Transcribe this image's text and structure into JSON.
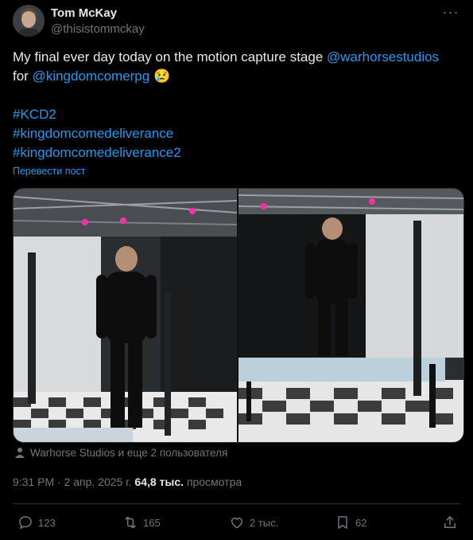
{
  "author": {
    "name": "Tom McKay",
    "handle": "@thisistommckay"
  },
  "post": {
    "text_part1": "My final ever day today on the motion capture stage ",
    "mention1": "@warhorsestudios",
    "text_part2": "for ",
    "mention2": "@kingdomcomerpg",
    "emoji": "😢",
    "hashtags": [
      "#KCD2",
      "#kingdomcomedeliverance",
      "#kingdomcomedeliverance2"
    ],
    "translate_label": "Перевести пост"
  },
  "tagged": {
    "text": "Warhorse Studios и еще 2 пользователя"
  },
  "meta": {
    "time": "9:31 PM",
    "separator": " · ",
    "date": "2 апр. 2025 г.",
    "views_value": "64,8 тыс.",
    "views_label": "просмотра"
  },
  "actions": {
    "replies": "123",
    "reposts": "165",
    "likes": "2 тыс.",
    "bookmarks": "62"
  },
  "colors": {
    "accent": "#1d9bf0",
    "muted": "#71767b",
    "text": "#e7e9ea",
    "background": "#000000"
  }
}
